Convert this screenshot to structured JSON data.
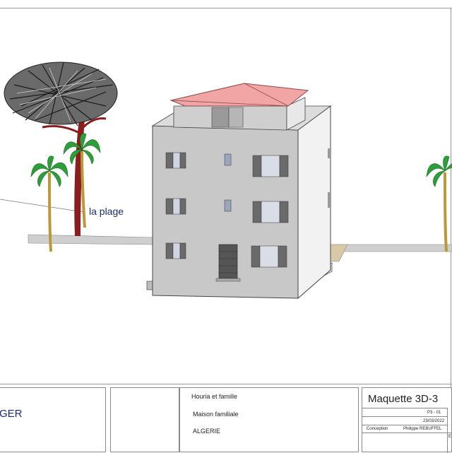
{
  "drawing": {
    "annotation": "la plage",
    "icons": [
      "pine-tree-icon",
      "palm-tree-icon",
      "house-3d-model"
    ]
  },
  "title_block": {
    "brand_fragment": "GER",
    "client_name": "Houria et famille",
    "project_type": "Maison familiale",
    "location": "ALGERIE",
    "sheet_title": "Maquette 3D-3",
    "sheet_number": "P3 - 01",
    "date": "23/03/2022",
    "designer_label": "Conception",
    "designer_name": "Philippe REBUFFEL",
    "scale_fragment": "E"
  },
  "colors": {
    "wall": "#c8c8c8",
    "wall_side": "#f2f2f2",
    "roof": "#f1a5a5",
    "shutter": "#6a6a6a",
    "palm_leaf": "#2e9e3a",
    "palm_trunk": "#b89a3a",
    "pine_trunk": "#8a1e1e",
    "label": "#1d2a6b"
  }
}
